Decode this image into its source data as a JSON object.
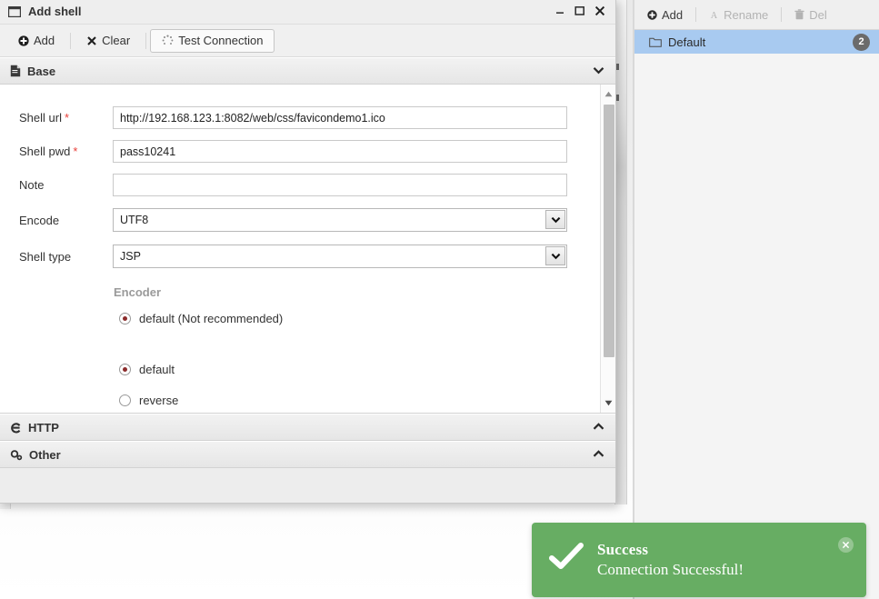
{
  "dialog": {
    "title": "Add shell",
    "window_icon": "window-icon",
    "controls": {
      "minimize": "‒",
      "maximize": "❐",
      "close": "✕"
    },
    "toolbar": [
      {
        "id": "add",
        "label": "Add",
        "icon": "plus-circle-icon",
        "framed": false
      },
      {
        "id": "clear",
        "label": "Clear",
        "icon": "cross-icon",
        "framed": false
      },
      {
        "id": "test-connection",
        "label": "Test Connection",
        "icon": "spinner-icon",
        "framed": true
      }
    ],
    "sections": [
      {
        "id": "base",
        "label": "Base",
        "icon": "document-icon",
        "chevron": "⌄",
        "expanded": true
      },
      {
        "id": "http",
        "label": "HTTP",
        "icon": "http-icon",
        "chevron": "⌃",
        "expanded": false
      },
      {
        "id": "other",
        "label": "Other",
        "icon": "gears-icon",
        "chevron": "⌃",
        "expanded": false
      }
    ],
    "form": {
      "fields": [
        {
          "id": "shell-url",
          "label": "Shell url",
          "required": true,
          "type": "text",
          "value": "http://192.168.123.1:8082/web/css/favicondemo1.ico",
          "placeholder": ""
        },
        {
          "id": "shell-pwd",
          "label": "Shell pwd",
          "required": true,
          "type": "text",
          "value": "pass10241",
          "placeholder": ""
        },
        {
          "id": "note",
          "label": "Note",
          "required": false,
          "type": "text",
          "value": "",
          "placeholder": ""
        },
        {
          "id": "encode",
          "label": "Encode",
          "required": false,
          "type": "select",
          "value": "UTF8",
          "placeholder": ""
        },
        {
          "id": "shell-type",
          "label": "Shell type",
          "required": false,
          "type": "select",
          "value": "JSP",
          "placeholder": ""
        }
      ],
      "encoder_group_title": "Encoder",
      "radios": [
        {
          "id": "encoder-default-nr",
          "label": "default (Not recommended)",
          "checked": true
        },
        {
          "id": "decoder-default",
          "label": "default",
          "checked": true
        },
        {
          "id": "decoder-reverse",
          "label": "reverse",
          "checked": false
        }
      ],
      "select_arrow": "⌄"
    },
    "scrollbar": {
      "up": "▲",
      "down": "▼"
    }
  },
  "right_panel": {
    "toolbar": [
      {
        "id": "add",
        "label": "Add",
        "icon": "plus-circle-icon",
        "disabled": false
      },
      {
        "id": "rename",
        "label": "Rename",
        "icon": "text-cursor-icon",
        "disabled": true
      },
      {
        "id": "del",
        "label": "Del",
        "icon": "trash-icon",
        "disabled": true
      }
    ],
    "items": [
      {
        "id": "default",
        "label": "Default",
        "icon": "folder-icon",
        "badge": "2",
        "selected": true
      }
    ]
  },
  "toast": {
    "icon": "check-icon",
    "title": "Success",
    "message": "Connection Successful!",
    "close": "✕",
    "color": "#67ad63"
  }
}
